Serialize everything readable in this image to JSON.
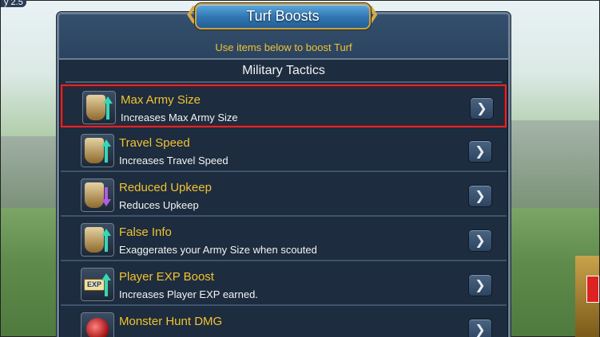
{
  "corner_text": "y 2.5",
  "dialog": {
    "title": "Turf Boosts",
    "subtitle": "Use items below to boost Turf",
    "section_title": "Military Tactics"
  },
  "boosts": [
    {
      "name": "Max Army Size",
      "description": "Increases Max Army Size",
      "icon": "army-size-shield-icon",
      "arrow": "up",
      "selected": true
    },
    {
      "name": "Travel Speed",
      "description": "Increases Travel Speed",
      "icon": "travel-speed-boot-icon",
      "arrow": "up",
      "selected": false
    },
    {
      "name": "Reduced Upkeep",
      "description": "Reduces Upkeep",
      "icon": "upkeep-soldier-icon",
      "arrow": "down",
      "selected": false
    },
    {
      "name": "False Info",
      "description": "Exaggerates your Army Size when scouted",
      "icon": "false-info-soldiers-icon",
      "arrow": "up",
      "selected": false
    },
    {
      "name": "Player EXP Boost",
      "description": "Increases Player EXP earned.",
      "icon": "exp-badge-icon",
      "arrow": "up",
      "badge_text": "EXP",
      "selected": false
    },
    {
      "name": "Monster Hunt DMG",
      "description": "",
      "icon": "monster-hunt-icon",
      "arrow": "none",
      "selected": false
    }
  ],
  "go_button_glyph": "❯",
  "colors": {
    "title_gold": "#f2c230",
    "panel_bg": "#1d2c3e",
    "selected_border": "#e0252b",
    "up_arrow": "#36d8b2",
    "down_arrow": "#b25de0"
  }
}
